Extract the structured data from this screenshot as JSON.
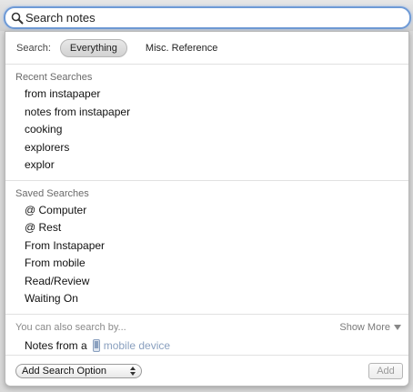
{
  "search": {
    "placeholder": "Search notes"
  },
  "scope": {
    "label": "Search:",
    "options": [
      {
        "label": "Everything",
        "active": true
      },
      {
        "label": "Misc. Reference",
        "active": false
      }
    ]
  },
  "recent": {
    "title": "Recent Searches",
    "items": [
      "from instapaper",
      "notes from instapaper",
      "cooking",
      "explorers",
      "explor"
    ]
  },
  "saved": {
    "title": "Saved Searches",
    "items": [
      "@ Computer",
      "@ Rest",
      "From Instapaper",
      "From mobile",
      "Read/Review",
      "Waiting On"
    ]
  },
  "also": {
    "title": "You can also search by...",
    "show_more": "Show More",
    "device_prefix": "Notes from a",
    "device_link": "mobile device"
  },
  "footer": {
    "select_label": "Add Search Option",
    "add_label": "Add"
  }
}
